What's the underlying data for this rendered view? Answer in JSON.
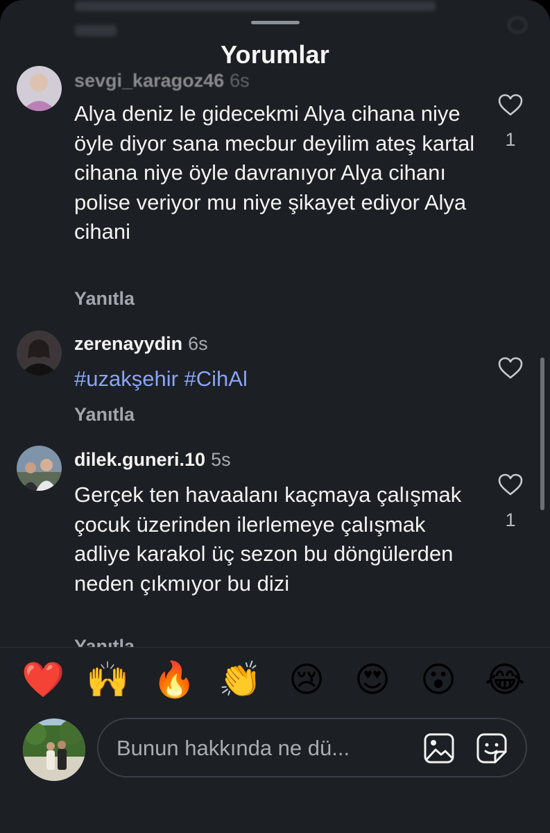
{
  "header": {
    "title": "Yorumlar"
  },
  "comments": [
    {
      "username": "sevgi_karagoz46",
      "time": "6s",
      "text": "Alya deniz le gidecekmi Alya cihana niye öyle diyor sana mecbur deyilim ateş kartal cihana niye öyle davranıyor Alya cihanı polise veriyor mu niye şikayet ediyor Alya cihani",
      "reply_label": "Yanıtla",
      "like_count": "1"
    },
    {
      "username": "zerenayydin",
      "time": "6s",
      "text": "#uzakşehir #CihAl",
      "reply_label": "Yanıtla",
      "like_count": ""
    },
    {
      "username": "dilek.guneri.10",
      "time": "5s",
      "text": "Gerçek ten havaalanı kaçmaya çalışmak çocuk üzerinden ilerlemeye çalışmak adliye karakol üç sezon bu döngülerden neden çıkmıyor bu dizi",
      "reply_label": "Yanıtla",
      "like_count": "1"
    }
  ],
  "reactions": [
    {
      "name": "heart",
      "glyph": "❤️"
    },
    {
      "name": "raised-hands",
      "glyph": "🙌"
    },
    {
      "name": "fire",
      "glyph": "🔥"
    },
    {
      "name": "clapping-hands",
      "glyph": "👏"
    },
    {
      "name": "crying-face",
      "glyph": "😢"
    },
    {
      "name": "heart-eyes",
      "glyph": "😍"
    },
    {
      "name": "surprised-face",
      "glyph": "😮"
    },
    {
      "name": "laughing-tears",
      "glyph": "😂"
    }
  ],
  "composer": {
    "placeholder": "Bunun hakkında ne dü..."
  },
  "icons": {
    "like": "heart-outline-icon",
    "gallery": "image-icon",
    "sticker": "sticker-icon"
  },
  "colors": {
    "background": "#1c1f24",
    "hashtag": "#8aa4f5",
    "muted": "#a3a6ac"
  }
}
